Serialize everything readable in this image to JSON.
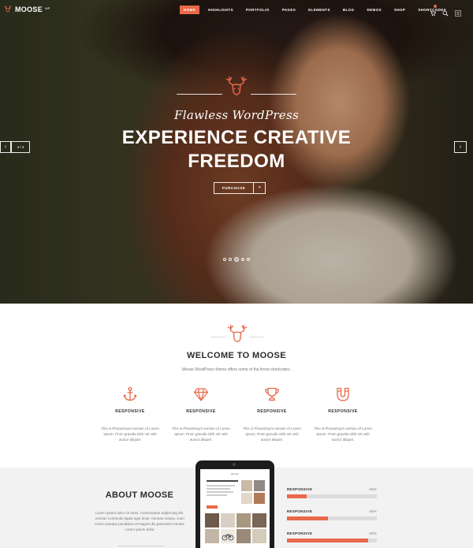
{
  "nav": {
    "logo_text": "MOOSE",
    "logo_sup": "WP",
    "items": [
      {
        "label": "HOME",
        "active": true
      },
      {
        "label": "HIGHLIGHTS",
        "active": false
      },
      {
        "label": "PORTFOLIO",
        "active": false
      },
      {
        "label": "PAGES",
        "active": false
      },
      {
        "label": "ELEMENTS",
        "active": false
      },
      {
        "label": "BLOG",
        "active": false
      },
      {
        "label": "DEMOS",
        "active": false
      },
      {
        "label": "SHOP",
        "active": false
      },
      {
        "label": "SHORTCODES",
        "active": false
      }
    ],
    "icons": [
      "cart-icon",
      "search-icon",
      "menu-icon"
    ]
  },
  "hero": {
    "script": "Flawless WordPress",
    "title_line1": "EXPERIENCE CREATIVE",
    "title_line2": "FREEDOM",
    "button_label": "PURCHASE",
    "button_arrow": "»",
    "counter": "4 / 4",
    "prev_arrow": "‹",
    "next_arrow": "›",
    "slides_total": 5,
    "active_slide": 3
  },
  "welcome": {
    "title": "WELCOME TO MOOSE",
    "subtitle": "Moose WordPress theme offers some of the finest shortcodes.",
    "features": [
      {
        "icon": "anchor-icon",
        "title": "RESPONSIVE",
        "text": "This is Photoshop's version of Lorem Ipsum. Proin gravida nibh vel velit auctor aliquet."
      },
      {
        "icon": "diamond-icon",
        "title": "RESPONSIVE",
        "text": "This is Photoshop's version of Lorem Ipsum. Proin gravida nibh vel velit auctor aliquet."
      },
      {
        "icon": "trophy-icon",
        "title": "RESPONSIVE",
        "text": "This is Photoshop's version of Lorem Ipsum. Proin gravida nibh vel velit auctor aliquet."
      },
      {
        "icon": "magnet-icon",
        "title": "RESPONSIVE",
        "text": "This is Photoshop's version of Lorem Ipsum. Proin gravida nibh vel velit auctor aliquet."
      }
    ]
  },
  "about": {
    "title": "ABOUT MOOSE",
    "text": "Lorem ipsum dolor sit amet, consectetuer adipiscing elit. Aenean commodo ligula eget dolor. Aenean massa. Cum sociis natoque penatibus et magnis dis parturient montes Lorem ipsum dolor",
    "tablet_script": "Moose",
    "skills": [
      {
        "label": "RESPONSIVE",
        "value_text": "45%",
        "fraction": 0.22
      },
      {
        "label": "RESPONSIVE",
        "value_text": "45%",
        "fraction": 0.46
      },
      {
        "label": "RESPONSIVE",
        "value_text": "45%",
        "fraction": 0.9
      }
    ]
  },
  "colors": {
    "accent": "#e8694a",
    "dark": "#2b2b2b",
    "muted": "#777777",
    "light_bg": "#f2f2f2"
  }
}
